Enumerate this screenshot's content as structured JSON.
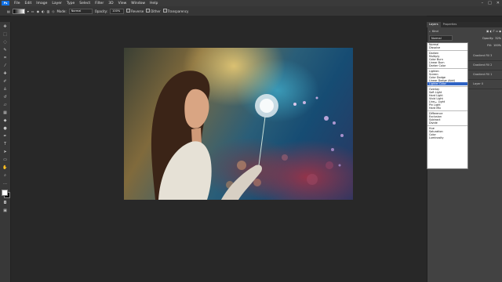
{
  "menubar": {
    "logo": "Ps",
    "items": [
      "File",
      "Edit",
      "Image",
      "Layer",
      "Type",
      "Select",
      "Filter",
      "3D",
      "View",
      "Window",
      "Help"
    ]
  },
  "options": {
    "mode_label": "Mode:",
    "mode_value": "Normal",
    "opacity_label": "Opacity:",
    "opacity_value": "100%",
    "reverse": "Reverse",
    "dither": "Dither",
    "transparency": "Transparency"
  },
  "panel": {
    "tab_layers": "Layers",
    "tab_properties": "Properties",
    "kind_label": "Kind",
    "blend_value": "Normal",
    "opacity_label": "Opacity:",
    "opacity_value": "32%",
    "fill_label": "Fill:",
    "fill_value": "100%",
    "layers": [
      "Gradient Fill 3",
      "Gradient Fill 2",
      "Gradient Fill 1",
      "Layer 0"
    ]
  },
  "blend_modes": {
    "groups": [
      [
        "Normal",
        "Dissolve"
      ],
      [
        "Darken",
        "Multiply",
        "Color Burn",
        "Linear Burn",
        "Darker Color"
      ],
      [
        "Lighten",
        "Screen",
        "Color Dodge",
        "Linear Dodge (Add)",
        "Lighter Color"
      ],
      [
        "Overlay",
        "Soft Light",
        "Hard Light",
        "Vivid Light",
        "Linear Light",
        "Pin Light",
        "Hard Mix"
      ],
      [
        "Difference",
        "Exclusion",
        "Subtract",
        "Divide"
      ],
      [
        "Hue",
        "Saturation",
        "Color",
        "Luminosity"
      ]
    ],
    "highlighted": "Lighter Color"
  }
}
